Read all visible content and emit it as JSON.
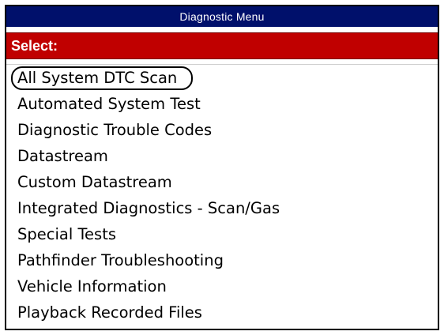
{
  "window": {
    "title": "Diagnostic Menu"
  },
  "header": {
    "select_label": "Select:"
  },
  "menu": {
    "selected_index": 0,
    "items": [
      {
        "label": "All System DTC Scan"
      },
      {
        "label": "Automated System Test"
      },
      {
        "label": "Diagnostic Trouble Codes"
      },
      {
        "label": "Datastream"
      },
      {
        "label": "Custom Datastream"
      },
      {
        "label": "Integrated Diagnostics - Scan/Gas"
      },
      {
        "label": "Special Tests"
      },
      {
        "label": "Pathfinder Troubleshooting"
      },
      {
        "label": "Vehicle Information"
      },
      {
        "label": "Playback Recorded Files"
      }
    ]
  },
  "colors": {
    "title_bar_background": "#00106b",
    "select_bar_background": "#c00000",
    "text": "#000000"
  }
}
